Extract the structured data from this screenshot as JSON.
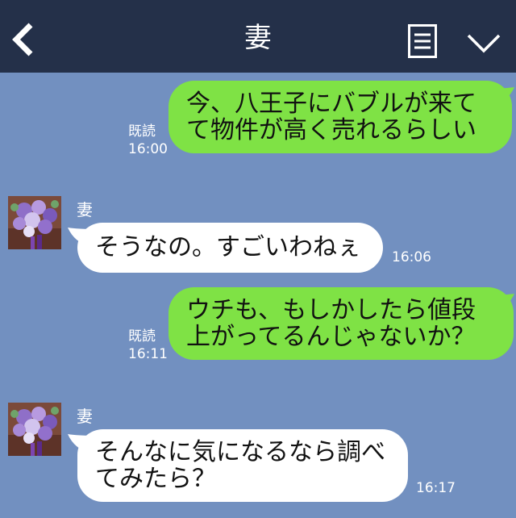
{
  "header": {
    "title": "妻"
  },
  "messages": [
    {
      "direction": "outgoing",
      "lines": [
        "今、八王子にバブルが来て",
        "て物件が高く売れるらしい"
      ],
      "read_label": "既読",
      "time": "16:00"
    },
    {
      "direction": "incoming",
      "sender": "妻",
      "lines": [
        "そうなの。すごいわねぇ"
      ],
      "time": "16:06"
    },
    {
      "direction": "outgoing",
      "lines": [
        "ウチも、もしかしたら値段",
        "上がってるんじゃないか？"
      ],
      "read_label": "既読",
      "time": "16:11"
    },
    {
      "direction": "incoming",
      "sender": "妻",
      "lines": [
        "そんなに気になるなら調べ",
        "てみたら？"
      ],
      "time": "16:17"
    }
  ],
  "colors": {
    "header_bg": "#243049",
    "chat_bg": "#7290c0",
    "outgoing_bubble": "#7fe245",
    "incoming_bubble": "#ffffff"
  },
  "icons": {
    "back": "back-chevron-icon",
    "menu": "menu-list-icon",
    "dropdown": "chevron-down-icon",
    "avatar": "flower-bouquet-avatar"
  }
}
